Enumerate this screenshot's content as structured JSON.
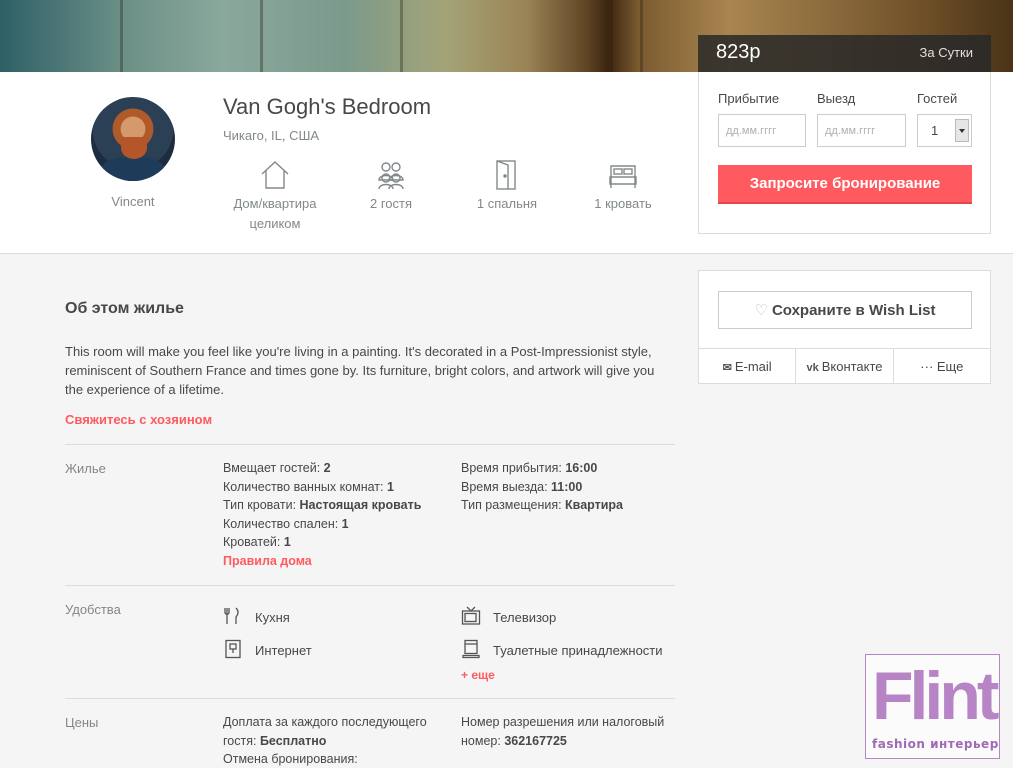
{
  "listing": {
    "title": "Van Gogh's Bedroom",
    "location": "Чикаго, IL, США",
    "host_name": "Vincent"
  },
  "features": [
    {
      "icon": "house-icon",
      "label": "Дом/квартира целиком"
    },
    {
      "icon": "guests-icon",
      "label": "2 гостя"
    },
    {
      "icon": "door-icon",
      "label": "1 спальня"
    },
    {
      "icon": "bed-icon",
      "label": "1 кровать"
    }
  ],
  "booking": {
    "price": "823р",
    "per": "За Сутки",
    "checkin_label": "Прибытие",
    "checkout_label": "Выезд",
    "guests_label": "Гостей",
    "date_placeholder": "дд.мм.гггг",
    "guests_value": "1",
    "request_button": "Запросите бронирование"
  },
  "wishlist": {
    "save_button": "Сохраните в Wish List",
    "email": "E-mail",
    "vk": "Вконтакте",
    "more": "··· Еще"
  },
  "about": {
    "heading": "Об этом жилье",
    "text": "This room will make you feel like you're living in a painting. It's decorated in a Post-Impressionist style, reminiscent of Southern France and times gone by. Its furniture, bright colors, and artwork will give you the experience of a lifetime.",
    "contact_link": "Свяжитесь с хозяином"
  },
  "housing": {
    "label": "Жилье",
    "left": [
      {
        "k": "Вмещает гостей: ",
        "v": "2"
      },
      {
        "k": "Количество ванных комнат: ",
        "v": "1"
      },
      {
        "k": "Тип кровати: ",
        "v": "Настоящая кровать"
      },
      {
        "k": "Количество спален: ",
        "v": "1"
      },
      {
        "k": "Кроватей: ",
        "v": "1"
      }
    ],
    "rules_link": "Правила дома",
    "right": [
      {
        "k": "Время прибытия: ",
        "v": "16:00"
      },
      {
        "k": "Время выезда: ",
        "v": "11:00"
      },
      {
        "k": "Тип размещения: ",
        "v": "Квартира"
      }
    ]
  },
  "amenities": {
    "label": "Удобства",
    "items": [
      {
        "icon": "kitchen-icon",
        "label": "Кухня"
      },
      {
        "icon": "tv-icon",
        "label": "Телевизор"
      },
      {
        "icon": "internet-icon",
        "label": "Интернет"
      },
      {
        "icon": "toiletries-icon",
        "label": "Туалетные принадлежности"
      }
    ],
    "more_link": "+ еще"
  },
  "prices": {
    "label": "Цены",
    "extra_guest_k": "Доплата за каждого последующего гостя: ",
    "extra_guest_v": "Бесплатно",
    "cancellation_k": "Отмена бронирования:",
    "permit_k": "Номер разрешения или налоговый номер: ",
    "permit_v": "362167725"
  },
  "watermark": {
    "logo_text": "Flint",
    "tagline": "fashion интерьер"
  }
}
